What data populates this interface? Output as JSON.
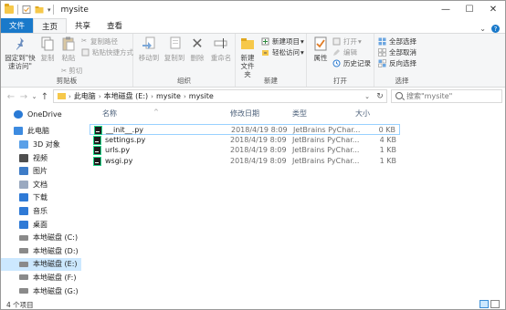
{
  "window": {
    "title": "mysite",
    "quick_access": [
      "folder-icon",
      "properties-icon",
      "new-folder-icon"
    ],
    "controls": {
      "minimize": "—",
      "maximize": "☐",
      "close": "✕"
    }
  },
  "tabs": {
    "file": "文件",
    "home": "主页",
    "share": "共享",
    "view": "查看"
  },
  "ribbon": {
    "clipboard": {
      "label": "剪贴板",
      "pin": "固定到\"快速访问\"",
      "copy": "复制",
      "paste": "粘贴",
      "cut": "剪切",
      "copy_path": "复制路径",
      "paste_shortcut": "粘贴快捷方式"
    },
    "organize": {
      "label": "组织",
      "move_to": "移动到",
      "copy_to": "复制到",
      "delete": "删除",
      "rename": "重命名"
    },
    "new": {
      "label": "新建",
      "new_folder": "新建文件夹",
      "new_item": "新建项目",
      "easy_access": "轻松访问"
    },
    "open": {
      "label": "打开",
      "properties": "属性",
      "open": "打开",
      "edit": "编辑",
      "history": "历史记录"
    },
    "select": {
      "label": "选择",
      "select_all": "全部选择",
      "select_none": "全部取消",
      "invert": "反向选择"
    }
  },
  "address": {
    "crumbs": [
      "此电脑",
      "本地磁盘 (E:)",
      "mysite",
      "mysite"
    ],
    "search_placeholder": "搜索\"mysite\""
  },
  "nav": {
    "items": [
      {
        "label": "OneDrive",
        "icon": "cloud-icon"
      },
      {
        "label": "此电脑",
        "icon": "computer-icon"
      },
      {
        "label": "3D 对象",
        "icon": "3d-objects-icon"
      },
      {
        "label": "视频",
        "icon": "video-icon"
      },
      {
        "label": "图片",
        "icon": "picture-icon"
      },
      {
        "label": "文档",
        "icon": "document-icon"
      },
      {
        "label": "下载",
        "icon": "download-icon"
      },
      {
        "label": "音乐",
        "icon": "music-icon"
      },
      {
        "label": "桌面",
        "icon": "desktop-icon"
      },
      {
        "label": "本地磁盘 (C:)",
        "icon": "drive-icon"
      },
      {
        "label": "本地磁盘 (D:)",
        "icon": "drive-icon"
      },
      {
        "label": "本地磁盘 (E:)",
        "icon": "drive-icon"
      },
      {
        "label": "本地磁盘 (F:)",
        "icon": "drive-icon"
      },
      {
        "label": "本地磁盘 (G:)",
        "icon": "drive-icon"
      },
      {
        "label": "网络",
        "icon": "network-icon"
      }
    ]
  },
  "columns": {
    "name": "名称",
    "date": "修改日期",
    "type": "类型",
    "size": "大小"
  },
  "files": [
    {
      "name": "__init__.py",
      "date": "2018/4/19 8:09",
      "type": "JetBrains PyChar...",
      "size": "0 KB"
    },
    {
      "name": "settings.py",
      "date": "2018/4/19 8:09",
      "type": "JetBrains PyChar...",
      "size": "4 KB"
    },
    {
      "name": "urls.py",
      "date": "2018/4/19 8:09",
      "type": "JetBrains PyChar...",
      "size": "1 KB"
    },
    {
      "name": "wsgi.py",
      "date": "2018/4/19 8:09",
      "type": "JetBrains PyChar...",
      "size": "1 KB"
    }
  ],
  "status": {
    "count": "4 个项目"
  },
  "colors": {
    "accent": "#1979ca",
    "selection": "#cce8ff",
    "selection_border": "#99d1ff",
    "header_text": "#4c607a"
  }
}
